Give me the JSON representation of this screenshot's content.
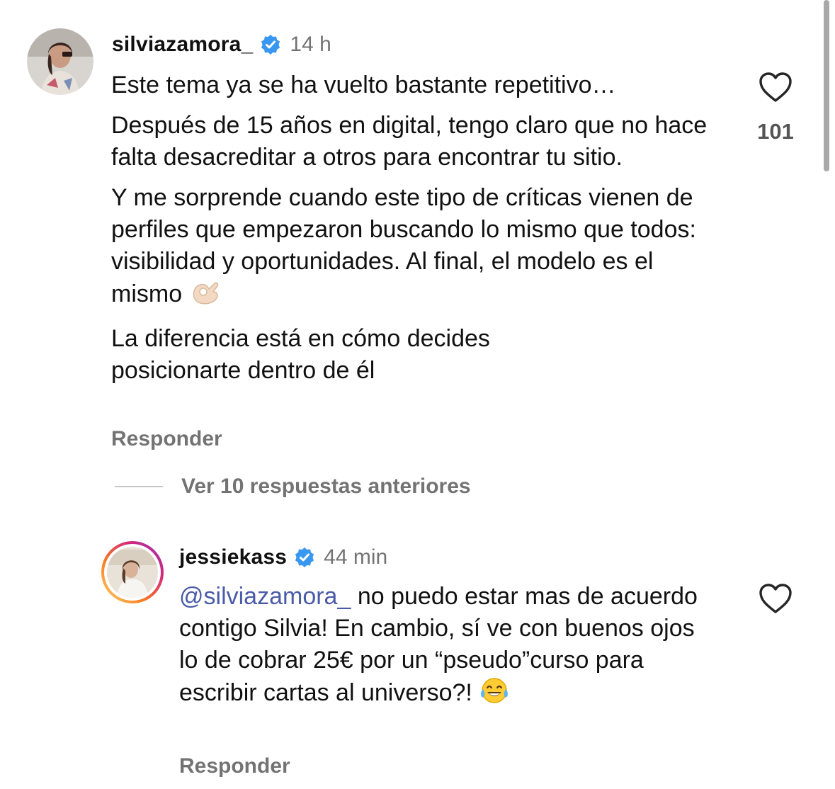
{
  "comments": [
    {
      "username": "silviazamora_",
      "time": "14 h",
      "paragraphs": [
        "Este tema ya se ha vuelto bastante repetitivo…",
        "Después de 15 años en digital, tengo claro que no hace falta desacreditar a otros para encontrar tu sitio.",
        "Y me sorprende cuando este tipo de críticas vienen de perfiles que empezaron buscando lo mismo que todos: visibilidad y oportunidades. Al final, el modelo es el mismo",
        "La diferencia está en cómo decides posicionarte dentro de él"
      ],
      "emoji": "ok-hand-emoji",
      "likes": "101",
      "reply_label": "Responder"
    },
    {
      "username": "jessiekass",
      "time": "44 min",
      "mention": "@silviazamora_",
      "text": " no puedo estar mas de acuerdo contigo Silvia! En cambio, sí ve con buenos ojos lo de cobrar 25€ por un “pseudo”curso para escribir cartas al universo?! ",
      "emoji": "tears-of-joy-emoji",
      "reply_label": "Responder"
    }
  ],
  "view_replies_label": "Ver 10 respuestas anteriores",
  "colors": {
    "verified": "#3897f0",
    "mention": "#4a5ba8",
    "secondary_text": "#737373",
    "story_ring": [
      "#feda75",
      "#fa7e1e",
      "#d62976",
      "#962fbf"
    ]
  }
}
